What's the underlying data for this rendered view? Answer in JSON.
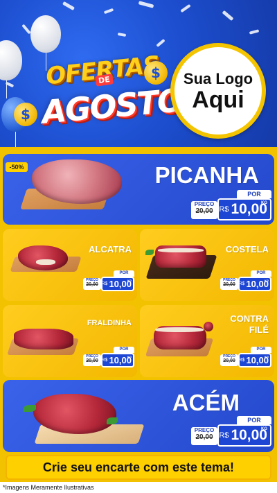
{
  "header": {
    "title_line1": "OFERTAS",
    "title_de": "DE",
    "title_line2": "AGOSTO",
    "coin_symbol": "$",
    "logo_line1": "Sua Logo",
    "logo_line2": "Aqui"
  },
  "products": [
    {
      "name": "PICANHA",
      "discount": "-50%",
      "por": "POR",
      "preco_label": "PREÇO",
      "old_price": "R$20,00",
      "old_cur": "R$",
      "old_num": "20,00",
      "currency": "R$",
      "price": "10,00",
      "unit": "KG"
    },
    {
      "name": "ALCATRA",
      "por": "POR",
      "preco_label": "PREÇO",
      "old_cur": "R$",
      "old_num": "20,00",
      "currency": "R$",
      "price": "10,00",
      "unit": "KG"
    },
    {
      "name": "COSTELA",
      "por": "POR",
      "preco_label": "PREÇO",
      "old_cur": "R$",
      "old_num": "20,00",
      "currency": "R$",
      "price": "10,00",
      "unit": "KG"
    },
    {
      "name": "FRALDINHA",
      "por": "POR",
      "preco_label": "PREÇO",
      "old_cur": "R$",
      "old_num": "20,00",
      "currency": "R$",
      "price": "10,00",
      "unit": "KG"
    },
    {
      "name_line1": "CONTRA",
      "name_line2": "FILÉ",
      "por": "POR",
      "preco_label": "PREÇO",
      "old_cur": "R$",
      "old_num": "20,00",
      "currency": "R$",
      "price": "10,00",
      "unit": "KG"
    },
    {
      "name": "ACÉM",
      "por": "POR",
      "preco_label": "PREÇO",
      "old_cur": "R$",
      "old_num": "20,00",
      "currency": "R$",
      "price": "10,00",
      "unit": "KG"
    }
  ],
  "cta": "Crie seu encarte com este tema!",
  "footer": "*Imagens Meramente Ilustrativas",
  "colors": {
    "blue": "#2448cc",
    "yellow": "#f3b800",
    "header_blue": "#1d4fd0"
  }
}
